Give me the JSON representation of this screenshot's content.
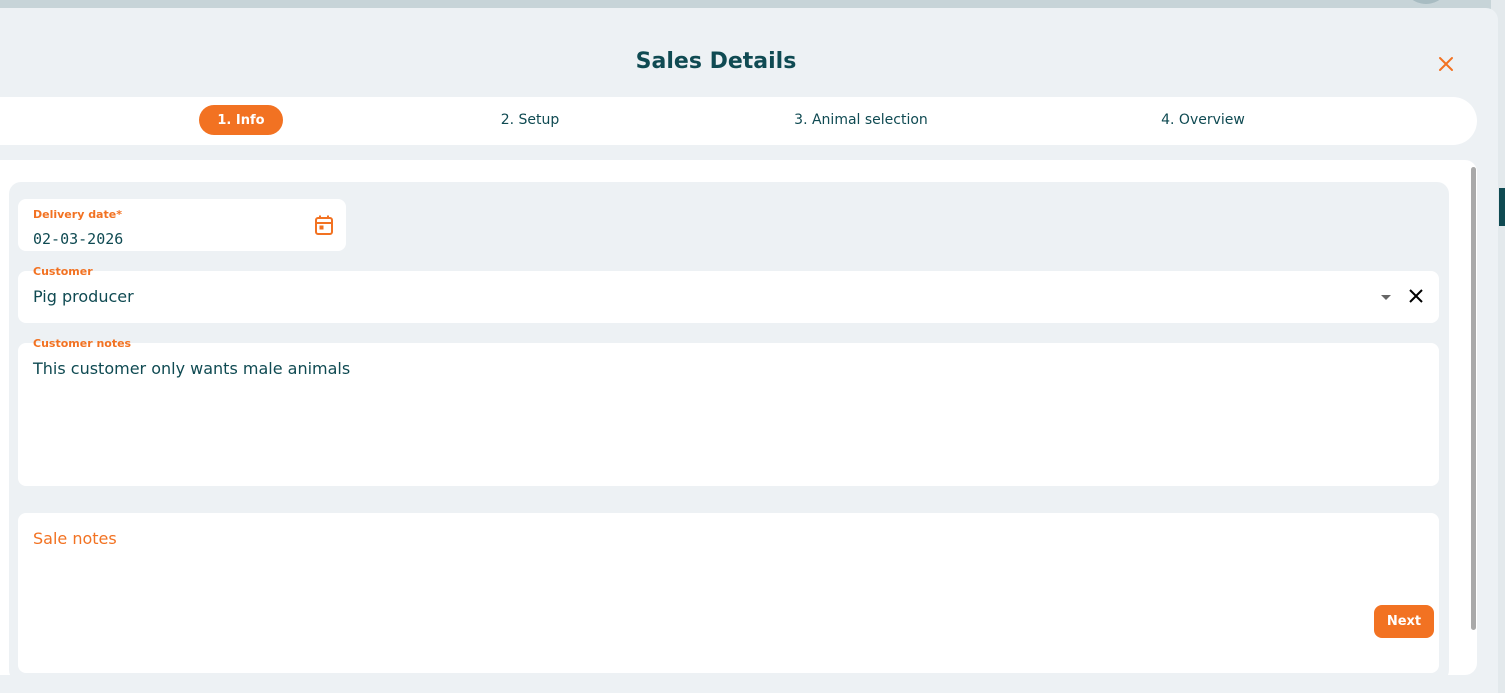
{
  "dialog": {
    "title": "Sales Details",
    "close_icon": "close-icon"
  },
  "steps": [
    {
      "label": "1. Info",
      "active": true
    },
    {
      "label": "2. Setup",
      "active": false
    },
    {
      "label": "3. Animal selection",
      "active": false
    },
    {
      "label": "4. Overview",
      "active": false
    }
  ],
  "form": {
    "delivery_date": {
      "label": "Delivery date*",
      "value": "02-03-2026",
      "icon": "calendar-icon"
    },
    "customer": {
      "label": "Customer",
      "value": "Pig producer",
      "dropdown_icon": "caret-down-icon",
      "clear_icon": "clear-icon"
    },
    "customer_notes": {
      "label": "Customer notes",
      "value": "This customer only wants male animals"
    },
    "sale_notes": {
      "placeholder": "Sale notes"
    }
  },
  "actions": {
    "next_label": "Next"
  },
  "colors": {
    "accent": "#f27222",
    "text": "#0f4a52",
    "background": "#edf1f4"
  }
}
